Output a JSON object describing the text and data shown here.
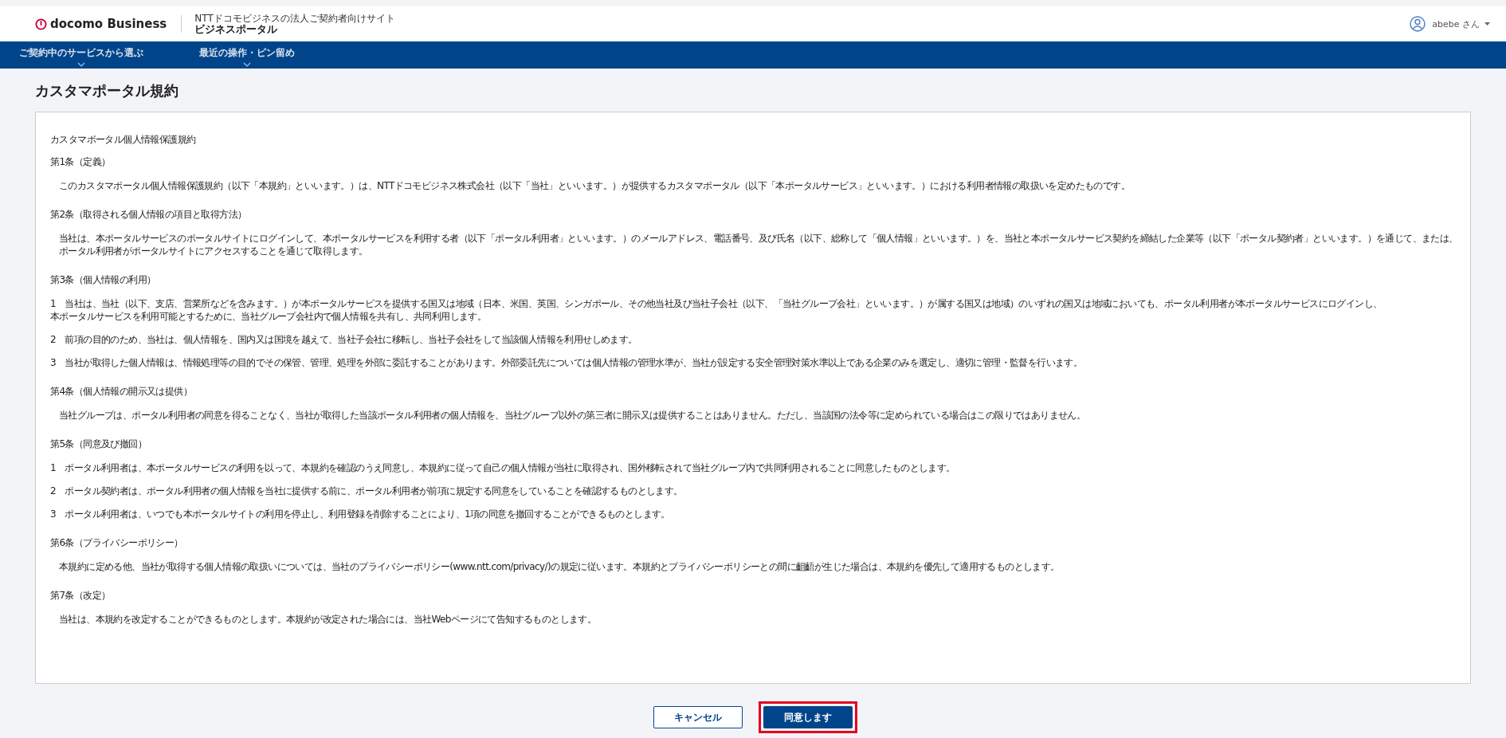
{
  "header": {
    "logo": "docomo Business",
    "site_caption": "NTTドコモビジネスの法人ご契約者向けサイト",
    "site_name": "ビジネスポータル",
    "user": "abebe さん"
  },
  "nav": [
    {
      "label": "ご契約中のサービスから選ぶ"
    },
    {
      "label": "最近の操作・ピン留め"
    }
  ],
  "page_title": "カスタマポータル規約",
  "terms": {
    "title": "カスタマポータル個人情報保護規約",
    "articles": [
      {
        "heading": "第1条（定義）",
        "paragraphs": [
          {
            "kind": "indented",
            "lines": [
              "このカスタマポータル個人情報保護規約（以下「本規約」といいます。）は、NTTドコモビジネス株式会社（以下「当社」といいます。）が提供するカスタマポータル（以下「本ポータルサービス」といいます。）における利用者情報の取扱いを定めたものです。"
            ]
          }
        ]
      },
      {
        "heading": "第2条（取得される個人情報の項目と取得方法）",
        "paragraphs": [
          {
            "kind": "indented",
            "lines": [
              "当社は、本ポータルサービスのポータルサイトにログインして、本ポータルサービスを利用する者（以下「ポータル利用者」といいます。）のメールアドレス、電話番号、及び氏名（以下、総称して「個人情報」といいます。）を、当社と本ポータルサービス契約を締結した企業等（以下「ポータル契約者」といいます。）を通じて、または、",
              "ポータル利用者がポータルサイトにアクセスすることを通じて取得します。"
            ]
          }
        ]
      },
      {
        "heading": "第3条（個人情報の利用）",
        "paragraphs": [
          {
            "kind": "numbered",
            "lines": [
              "1　当社は、当社（以下、支店、営業所などを含みます。）が本ポータルサービスを提供する国又は地域（日本、米国、英国、シンガポール、その他当社及び当社子会社（以下、「当社グループ会社」といいます。）が属する国又は地域）のいずれの国又は地域においても、ポータル利用者が本ポータルサービスにログインし、",
              "本ポータルサービスを利用可能とするために、当社グループ会社内で個人情報を共有し、共同利用します。"
            ]
          },
          {
            "kind": "numbered",
            "lines": [
              "2　前項の目的のため、当社は、個人情報を、国内又は国境を越えて、当社子会社に移転し、当社子会社をして当該個人情報を利用せしめます。"
            ]
          },
          {
            "kind": "numbered",
            "lines": [
              "3　当社が取得した個人情報は、情報処理等の目的でその保管、管理、処理を外部に委託することがあります。外部委託先については個人情報の管理水準が、当社が設定する安全管理対策水準以上である企業のみを選定し、適切に管理・監督を行います。"
            ]
          }
        ]
      },
      {
        "heading": "第4条（個人情報の開示又は提供）",
        "paragraphs": [
          {
            "kind": "indented",
            "lines": [
              "当社グループは、ポータル利用者の同意を得ることなく、当社が取得した当該ポータル利用者の個人情報を、当社グループ以外の第三者に開示又は提供することはありません。ただし、当該国の法令等に定められている場合はこの限りではありません。"
            ]
          }
        ]
      },
      {
        "heading": "第5条（同意及び撤回）",
        "paragraphs": [
          {
            "kind": "numbered",
            "lines": [
              "1　ポータル利用者は、本ポータルサービスの利用を以って、本規約を確認のうえ同意し、本規約に従って自己の個人情報が当社に取得され、国外移転されて当社グループ内で共同利用されることに同意したものとします。"
            ]
          },
          {
            "kind": "numbered",
            "lines": [
              "2　ポータル契約者は、ポータル利用者の個人情報を当社に提供する前に、ポータル利用者が前項に規定する同意をしていることを確認するものとします。"
            ]
          },
          {
            "kind": "numbered",
            "lines": [
              "3　ポータル利用者は、いつでも本ポータルサイトの利用を停止し、利用登録を削除することにより、1項の同意を撤回することができるものとします。"
            ]
          }
        ]
      },
      {
        "heading": "第6条（プライバシーポリシー）",
        "paragraphs": [
          {
            "kind": "indented",
            "lines": [
              "本規約に定める他、当社が取得する個人情報の取扱いについては、当社のプライバシーポリシー(www.ntt.com/privacy/)の規定に従います。本規約とプライバシーポリシーとの間に齟齬が生じた場合は、本規約を優先して適用するものとします。"
            ]
          }
        ]
      },
      {
        "heading": "第7条（改定）",
        "paragraphs": [
          {
            "kind": "indented",
            "lines": [
              "当社は、本規約を改定することができるものとします。本規約が改定された場合には、当社Webページにて告知するものとします。"
            ]
          }
        ]
      }
    ]
  },
  "buttons": [
    {
      "label": "キャンセル",
      "kind": "secondary",
      "highlighted": false
    },
    {
      "label": "同意します",
      "kind": "primary",
      "highlighted": true
    }
  ]
}
